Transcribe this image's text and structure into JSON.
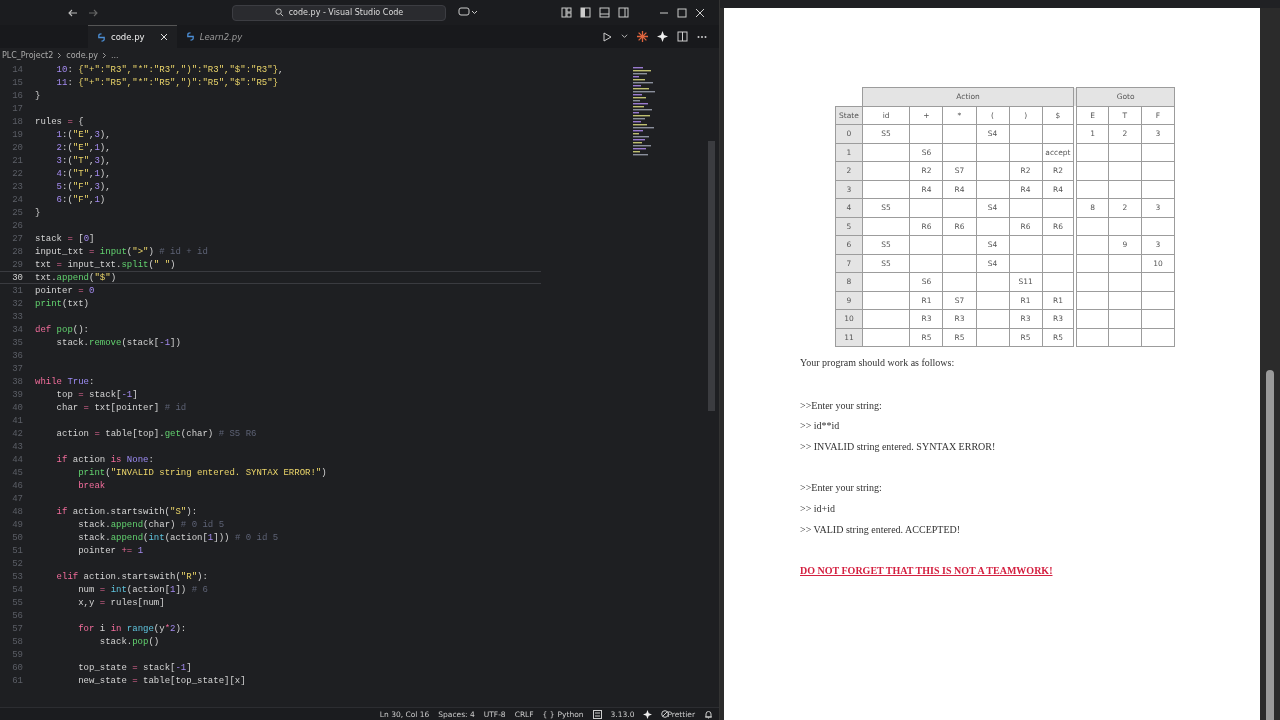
{
  "window": {
    "title": "code.py - Visual Studio Code"
  },
  "tabs": [
    {
      "label": "code.py",
      "selected": true,
      "preview": false
    },
    {
      "label": "Learn2.py",
      "selected": false,
      "preview": true
    }
  ],
  "breadcrumb": [
    "PLC_Project2",
    "code.py",
    "..."
  ],
  "editor": {
    "lines": [
      {
        "number": "14",
        "current": false,
        "tokens": [
          {
            "text": "    10",
            "kind": "number"
          },
          {
            "text": ": ",
            "kind": "plain"
          },
          {
            "text": "{\"+\":\"R3\",\"*\":\"R3\",\")\":\"R3\",\"$\":\"R3\"}",
            "kind": "string"
          },
          {
            "text": ",",
            "kind": "plain"
          }
        ]
      },
      {
        "number": "15",
        "current": false,
        "tokens": [
          {
            "text": "    11",
            "kind": "number"
          },
          {
            "text": ": ",
            "kind": "plain"
          },
          {
            "text": "{\"+\":\"R5\",\"*\":\"R5\",\")\":\"R5\",\"$\":\"R5\"}",
            "kind": "string"
          }
        ]
      },
      {
        "number": "16",
        "current": false,
        "tokens": [
          {
            "text": "}",
            "kind": "plain"
          }
        ]
      },
      {
        "number": "17",
        "current": false
      },
      {
        "number": "18",
        "current": false,
        "tokens": [
          {
            "text": "rules ",
            "kind": "plain"
          },
          {
            "text": "=",
            "kind": "keyword"
          },
          {
            "text": " {",
            "kind": "plain"
          }
        ]
      },
      {
        "number": "19",
        "current": false,
        "tokens": [
          {
            "text": "    1",
            "kind": "number"
          },
          {
            "text": ":(",
            "kind": "plain"
          },
          {
            "text": "\"E\"",
            "kind": "string"
          },
          {
            "text": ",",
            "kind": "plain"
          },
          {
            "text": "3",
            "kind": "number"
          },
          {
            "text": "),",
            "kind": "plain"
          }
        ]
      },
      {
        "number": "20",
        "current": false,
        "tokens": [
          {
            "text": "    2",
            "kind": "number"
          },
          {
            "text": ":(",
            "kind": "plain"
          },
          {
            "text": "\"E\"",
            "kind": "string"
          },
          {
            "text": ",",
            "kind": "plain"
          },
          {
            "text": "1",
            "kind": "number"
          },
          {
            "text": "),",
            "kind": "plain"
          }
        ]
      },
      {
        "number": "21",
        "current": false,
        "tokens": [
          {
            "text": "    3",
            "kind": "number"
          },
          {
            "text": ":(",
            "kind": "plain"
          },
          {
            "text": "\"T\"",
            "kind": "string"
          },
          {
            "text": ",",
            "kind": "plain"
          },
          {
            "text": "3",
            "kind": "number"
          },
          {
            "text": "),",
            "kind": "plain"
          }
        ]
      },
      {
        "number": "22",
        "current": false,
        "tokens": [
          {
            "text": "    4",
            "kind": "number"
          },
          {
            "text": ":(",
            "kind": "plain"
          },
          {
            "text": "\"T\"",
            "kind": "string"
          },
          {
            "text": ",",
            "kind": "plain"
          },
          {
            "text": "1",
            "kind": "number"
          },
          {
            "text": "),",
            "kind": "plain"
          }
        ]
      },
      {
        "number": "23",
        "current": false,
        "tokens": [
          {
            "text": "    5",
            "kind": "number"
          },
          {
            "text": ":(",
            "kind": "plain"
          },
          {
            "text": "\"F\"",
            "kind": "string"
          },
          {
            "text": ",",
            "kind": "plain"
          },
          {
            "text": "3",
            "kind": "number"
          },
          {
            "text": "),",
            "kind": "plain"
          }
        ]
      },
      {
        "number": "24",
        "current": false,
        "tokens": [
          {
            "text": "    6",
            "kind": "number"
          },
          {
            "text": ":(",
            "kind": "plain"
          },
          {
            "text": "\"F\"",
            "kind": "string"
          },
          {
            "text": ",",
            "kind": "plain"
          },
          {
            "text": "1",
            "kind": "number"
          },
          {
            "text": ")",
            "kind": "plain"
          }
        ]
      },
      {
        "number": "25",
        "current": false,
        "tokens": [
          {
            "text": "}",
            "kind": "plain"
          }
        ]
      },
      {
        "number": "26",
        "current": false
      },
      {
        "number": "27",
        "current": false,
        "tokens": [
          {
            "text": "stack ",
            "kind": "plain"
          },
          {
            "text": "=",
            "kind": "keyword"
          },
          {
            "text": " [",
            "kind": "plain"
          },
          {
            "text": "0",
            "kind": "number"
          },
          {
            "text": "]",
            "kind": "plain"
          }
        ]
      },
      {
        "number": "28",
        "current": false,
        "tokens": [
          {
            "text": "input_txt ",
            "kind": "plain"
          },
          {
            "text": "= ",
            "kind": "keyword"
          },
          {
            "text": "input",
            "kind": "call"
          },
          {
            "text": "(",
            "kind": "plain"
          },
          {
            "text": "\">\"",
            "kind": "string"
          },
          {
            "text": ") ",
            "kind": "plain"
          },
          {
            "text": "# id + id",
            "kind": "comment"
          }
        ]
      },
      {
        "number": "29",
        "current": false,
        "tokens": [
          {
            "text": "txt ",
            "kind": "plain"
          },
          {
            "text": "=",
            "kind": "keyword"
          },
          {
            "text": " input_txt.",
            "kind": "plain"
          },
          {
            "text": "split",
            "kind": "call"
          },
          {
            "text": "(",
            "kind": "plain"
          },
          {
            "text": "\" \"",
            "kind": "string"
          },
          {
            "text": ")",
            "kind": "plain"
          }
        ]
      },
      {
        "number": "30",
        "current": true,
        "tokens": [
          {
            "text": "txt.",
            "kind": "plain"
          },
          {
            "text": "append",
            "kind": "call"
          },
          {
            "text": "(",
            "kind": "plain"
          },
          {
            "text": "\"$\"",
            "kind": "string"
          },
          {
            "text": ")",
            "kind": "plain"
          }
        ]
      },
      {
        "number": "31",
        "current": false,
        "tokens": [
          {
            "text": "pointer ",
            "kind": "plain"
          },
          {
            "text": "= ",
            "kind": "keyword"
          },
          {
            "text": "0",
            "kind": "number"
          }
        ]
      },
      {
        "number": "32",
        "current": false,
        "tokens": [
          {
            "text": "print",
            "kind": "call"
          },
          {
            "text": "(txt)",
            "kind": "plain"
          }
        ]
      },
      {
        "number": "33",
        "current": false
      },
      {
        "number": "34",
        "current": false,
        "tokens": [
          {
            "text": "def ",
            "kind": "keyword"
          },
          {
            "text": "pop",
            "kind": "call"
          },
          {
            "text": "():",
            "kind": "plain"
          }
        ]
      },
      {
        "number": "35",
        "current": false,
        "tokens": [
          {
            "text": "    stack.",
            "kind": "plain"
          },
          {
            "text": "remove",
            "kind": "call"
          },
          {
            "text": "(stack[",
            "kind": "plain"
          },
          {
            "text": "-1",
            "kind": "number"
          },
          {
            "text": "])",
            "kind": "plain"
          }
        ]
      },
      {
        "number": "36",
        "current": false
      },
      {
        "number": "37",
        "current": false
      },
      {
        "number": "38",
        "current": false,
        "tokens": [
          {
            "text": "while ",
            "kind": "keyword"
          },
          {
            "text": "True",
            "kind": "constant"
          },
          {
            "text": ":",
            "kind": "plain"
          }
        ]
      },
      {
        "number": "39",
        "current": false,
        "tokens": [
          {
            "text": "    top ",
            "kind": "plain"
          },
          {
            "text": "=",
            "kind": "keyword"
          },
          {
            "text": " stack[",
            "kind": "plain"
          },
          {
            "text": "-1",
            "kind": "number"
          },
          {
            "text": "]",
            "kind": "plain"
          }
        ]
      },
      {
        "number": "40",
        "current": false,
        "tokens": [
          {
            "text": "    char ",
            "kind": "plain"
          },
          {
            "text": "=",
            "kind": "keyword"
          },
          {
            "text": " txt[pointer] ",
            "kind": "plain"
          },
          {
            "text": "# id",
            "kind": "comment"
          }
        ]
      },
      {
        "number": "41",
        "current": false
      },
      {
        "number": "42",
        "current": false,
        "tokens": [
          {
            "text": "    action ",
            "kind": "plain"
          },
          {
            "text": "=",
            "kind": "keyword"
          },
          {
            "text": " table[top].",
            "kind": "plain"
          },
          {
            "text": "get",
            "kind": "call"
          },
          {
            "text": "(char) ",
            "kind": "plain"
          },
          {
            "text": "# S5 R6",
            "kind": "comment"
          }
        ]
      },
      {
        "number": "43",
        "current": false
      },
      {
        "number": "44",
        "current": false,
        "tokens": [
          {
            "text": "    if",
            "kind": "keyword"
          },
          {
            "text": " action ",
            "kind": "plain"
          },
          {
            "text": "is ",
            "kind": "keyword"
          },
          {
            "text": "None",
            "kind": "constant"
          },
          {
            "text": ":",
            "kind": "plain"
          }
        ]
      },
      {
        "number": "45",
        "current": false,
        "tokens": [
          {
            "text": "        print",
            "kind": "call"
          },
          {
            "text": "(",
            "kind": "plain"
          },
          {
            "text": "\"INVALID string entered. SYNTAX ERROR!\"",
            "kind": "string"
          },
          {
            "text": ")",
            "kind": "plain"
          }
        ]
      },
      {
        "number": "46",
        "current": false,
        "tokens": [
          {
            "text": "        break",
            "kind": "keyword"
          }
        ]
      },
      {
        "number": "47",
        "current": false
      },
      {
        "number": "48",
        "current": false,
        "tokens": [
          {
            "text": "    if",
            "kind": "keyword"
          },
          {
            "text": " action.startswith(",
            "kind": "plain"
          },
          {
            "text": "\"S\"",
            "kind": "string"
          },
          {
            "text": "):",
            "kind": "plain"
          }
        ]
      },
      {
        "number": "49",
        "current": false,
        "tokens": [
          {
            "text": "        stack.",
            "kind": "plain"
          },
          {
            "text": "append",
            "kind": "call"
          },
          {
            "text": "(char) ",
            "kind": "plain"
          },
          {
            "text": "# 0 id 5",
            "kind": "comment"
          }
        ]
      },
      {
        "number": "50",
        "current": false,
        "tokens": [
          {
            "text": "        stack.",
            "kind": "plain"
          },
          {
            "text": "append",
            "kind": "call"
          },
          {
            "text": "(",
            "kind": "plain"
          },
          {
            "text": "int",
            "kind": "builtin"
          },
          {
            "text": "(action[",
            "kind": "plain"
          },
          {
            "text": "1",
            "kind": "number"
          },
          {
            "text": "])) ",
            "kind": "plain"
          },
          {
            "text": "# 0 id 5",
            "kind": "comment"
          }
        ]
      },
      {
        "number": "51",
        "current": false,
        "tokens": [
          {
            "text": "        pointer ",
            "kind": "plain"
          },
          {
            "text": "+= ",
            "kind": "keyword"
          },
          {
            "text": "1",
            "kind": "number"
          }
        ]
      },
      {
        "number": "52",
        "current": false
      },
      {
        "number": "53",
        "current": false,
        "tokens": [
          {
            "text": "    elif",
            "kind": "keyword"
          },
          {
            "text": " action.startswith(",
            "kind": "plain"
          },
          {
            "text": "\"R\"",
            "kind": "string"
          },
          {
            "text": "):",
            "kind": "plain"
          }
        ]
      },
      {
        "number": "54",
        "current": false,
        "tokens": [
          {
            "text": "        num ",
            "kind": "plain"
          },
          {
            "text": "= ",
            "kind": "keyword"
          },
          {
            "text": "int",
            "kind": "builtin"
          },
          {
            "text": "(action[",
            "kind": "plain"
          },
          {
            "text": "1",
            "kind": "number"
          },
          {
            "text": "]) ",
            "kind": "plain"
          },
          {
            "text": "# 6",
            "kind": "comment"
          }
        ]
      },
      {
        "number": "55",
        "current": false,
        "tokens": [
          {
            "text": "        x,y ",
            "kind": "plain"
          },
          {
            "text": "=",
            "kind": "keyword"
          },
          {
            "text": " rules[num]",
            "kind": "plain"
          }
        ]
      },
      {
        "number": "56",
        "current": false
      },
      {
        "number": "57",
        "current": false,
        "tokens": [
          {
            "text": "        for",
            "kind": "keyword"
          },
          {
            "text": " i ",
            "kind": "plain"
          },
          {
            "text": "in ",
            "kind": "keyword"
          },
          {
            "text": "range",
            "kind": "builtin"
          },
          {
            "text": "(y",
            "kind": "plain"
          },
          {
            "text": "*",
            "kind": "keyword"
          },
          {
            "text": "2",
            "kind": "number"
          },
          {
            "text": "):",
            "kind": "plain"
          }
        ]
      },
      {
        "number": "58",
        "current": false,
        "tokens": [
          {
            "text": "            stack.",
            "kind": "plain"
          },
          {
            "text": "pop",
            "kind": "call"
          },
          {
            "text": "()",
            "kind": "plain"
          }
        ]
      },
      {
        "number": "59",
        "current": false
      },
      {
        "number": "60",
        "current": false,
        "tokens": [
          {
            "text": "        top_state ",
            "kind": "plain"
          },
          {
            "text": "=",
            "kind": "keyword"
          },
          {
            "text": " stack[",
            "kind": "plain"
          },
          {
            "text": "-1",
            "kind": "number"
          },
          {
            "text": "]",
            "kind": "plain"
          }
        ]
      },
      {
        "number": "61",
        "current": false,
        "tokens": [
          {
            "text": "        new_state ",
            "kind": "plain"
          },
          {
            "text": "=",
            "kind": "keyword"
          },
          {
            "text": " table[top_state][x]",
            "kind": "plain"
          }
        ]
      }
    ]
  },
  "status_bar": {
    "items": [
      "Ln 30, Col 16",
      "Spaces: 4",
      "UTF-8",
      "CRLF"
    ],
    "language_brace": "{ }",
    "language": "Python",
    "version": "3.13.0",
    "formatter": "Prettier"
  },
  "document": {
    "parse_table": {
      "corner": "State",
      "groups": [
        {
          "label": "Action",
          "columns": [
            "id",
            "+",
            "*",
            "(",
            ")",
            "$"
          ]
        },
        {
          "label": "Goto",
          "columns": [
            "E",
            "T",
            "F"
          ]
        }
      ],
      "rows": [
        {
          "state": "0",
          "cells": [
            "S5",
            null,
            null,
            "S4",
            null,
            null,
            "1",
            "2",
            "3"
          ]
        },
        {
          "state": "1",
          "cells": [
            null,
            "S6",
            null,
            null,
            null,
            "accept",
            null,
            null,
            null
          ]
        },
        {
          "state": "2",
          "cells": [
            null,
            "R2",
            "S7",
            null,
            "R2",
            "R2",
            null,
            null,
            null
          ]
        },
        {
          "state": "3",
          "cells": [
            null,
            "R4",
            "R4",
            null,
            "R4",
            "R4",
            null,
            null,
            null
          ]
        },
        {
          "state": "4",
          "cells": [
            "S5",
            null,
            null,
            "S4",
            null,
            null,
            "8",
            "2",
            "3"
          ]
        },
        {
          "state": "5",
          "cells": [
            null,
            "R6",
            "R6",
            null,
            "R6",
            "R6",
            null,
            null,
            null
          ]
        },
        {
          "state": "6",
          "cells": [
            "S5",
            null,
            null,
            "S4",
            null,
            null,
            null,
            "9",
            "3"
          ]
        },
        {
          "state": "7",
          "cells": [
            "S5",
            null,
            null,
            "S4",
            null,
            null,
            null,
            null,
            "10"
          ]
        },
        {
          "state": "8",
          "cells": [
            null,
            "S6",
            null,
            null,
            "S11",
            null,
            null,
            null,
            null
          ]
        },
        {
          "state": "9",
          "cells": [
            null,
            "R1",
            "S7",
            null,
            "R1",
            "R1",
            null,
            null,
            null
          ]
        },
        {
          "state": "10",
          "cells": [
            null,
            "R3",
            "R3",
            null,
            "R3",
            "R3",
            null,
            null,
            null
          ]
        },
        {
          "state": "11",
          "cells": [
            null,
            "R5",
            "R5",
            null,
            "R5",
            "R5",
            null,
            null,
            null
          ]
        }
      ]
    },
    "intro": "Your program should work as follows:",
    "examples": [
      [
        ">>Enter your string:",
        ">> id**id",
        ">> INVALID string entered. SYNTAX ERROR!"
      ],
      [
        ">>Enter your string:",
        ">> id+id",
        ">> VALID string entered. ACCEPTED!"
      ]
    ],
    "warning": "DO NOT FORGET THAT THIS IS NOT A TEAMWORK!"
  }
}
